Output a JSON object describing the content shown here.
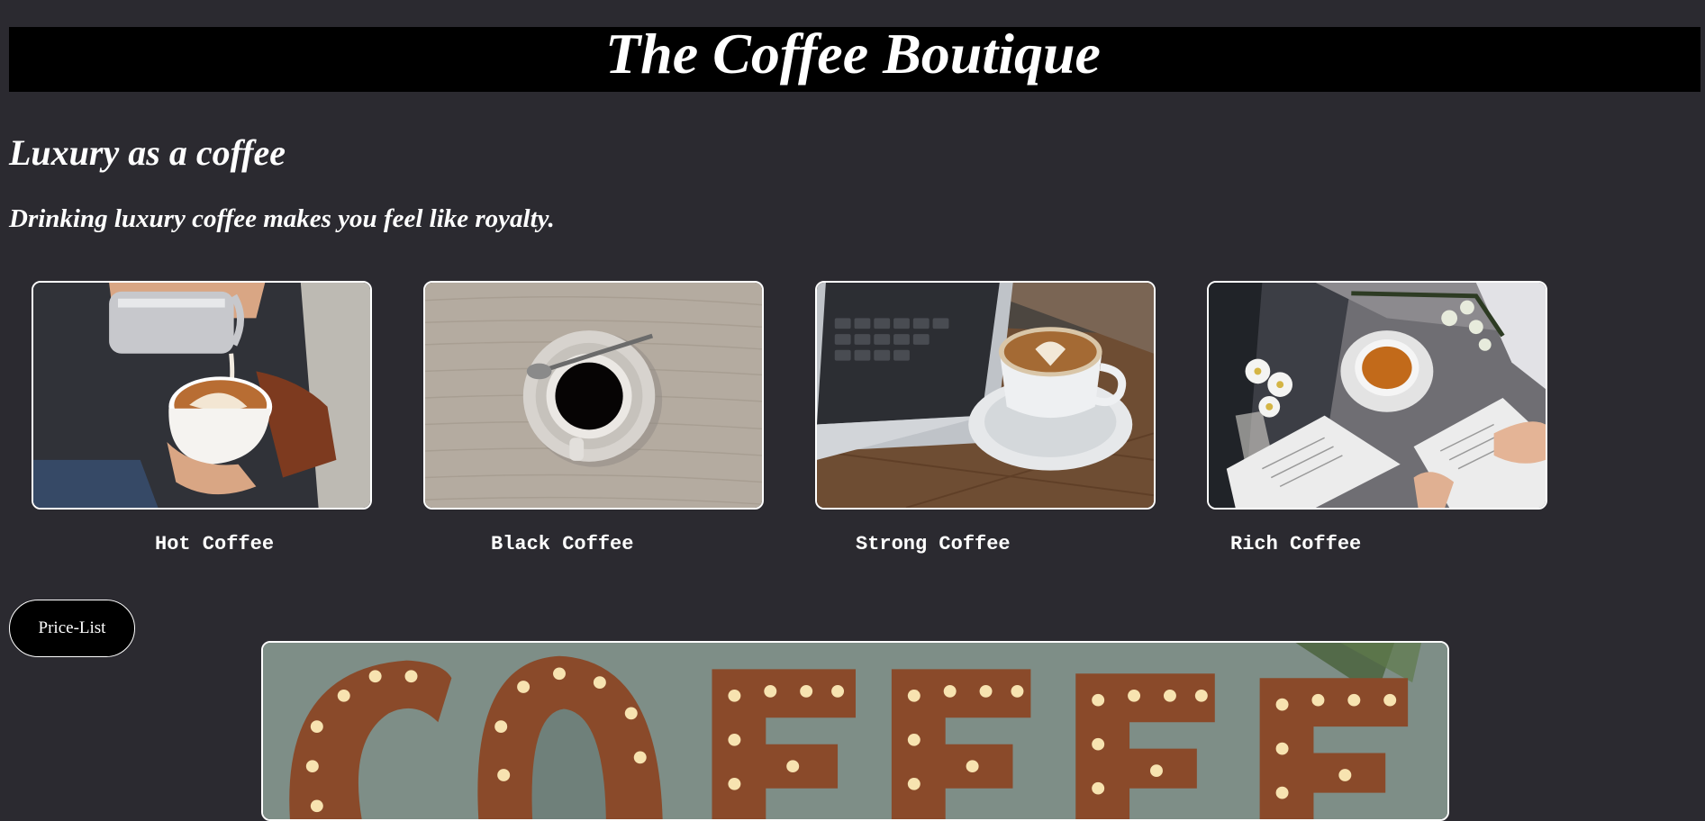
{
  "header": {
    "title": "The Coffee Boutique"
  },
  "intro": {
    "tagline": "Luxury as a coffee",
    "subline": "Drinking luxury coffee makes you feel like royalty."
  },
  "cards": [
    {
      "label": "Hot Coffee",
      "image": "latte-art-pour-photo"
    },
    {
      "label": "Black Coffee",
      "image": "black-coffee-cup-photo"
    },
    {
      "label": "Strong Coffee",
      "image": "cappuccino-laptop-photo"
    },
    {
      "label": "Rich Coffee",
      "image": "tea-books-flowers-photo"
    }
  ],
  "price_button": {
    "label": "Price-List"
  },
  "banner": {
    "image": "coffee-marquee-sign-photo"
  },
  "colors": {
    "page_background": "#2b2a30",
    "header_background": "#000000",
    "text": "#ffffff",
    "button_background": "#000000"
  }
}
